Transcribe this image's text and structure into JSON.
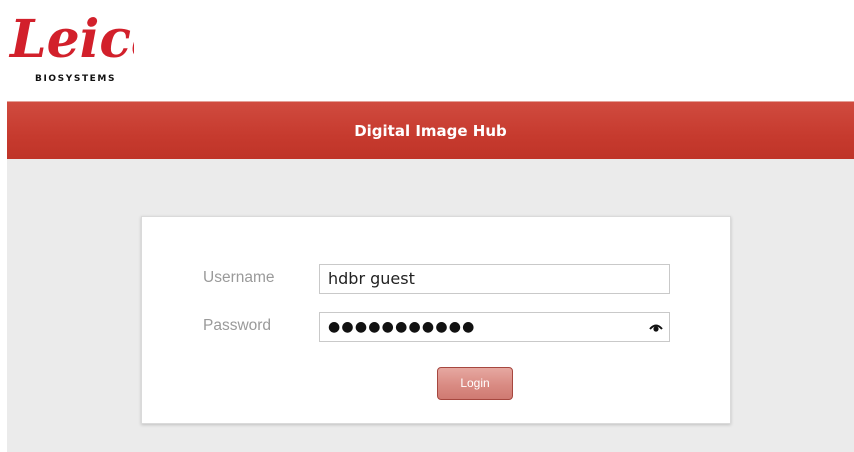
{
  "brand": {
    "logo_text": "Leica",
    "logo_subtitle": "BIOSYSTEMS",
    "accent_color": "#c63a2e"
  },
  "header": {
    "title": "Digital Image Hub"
  },
  "login_form": {
    "username_label": "Username",
    "username_value": "hdbr guest",
    "password_label": "Password",
    "password_value": "●●●●●●●●●●●",
    "reveal_icon": "eye-icon",
    "login_label": "Login"
  }
}
